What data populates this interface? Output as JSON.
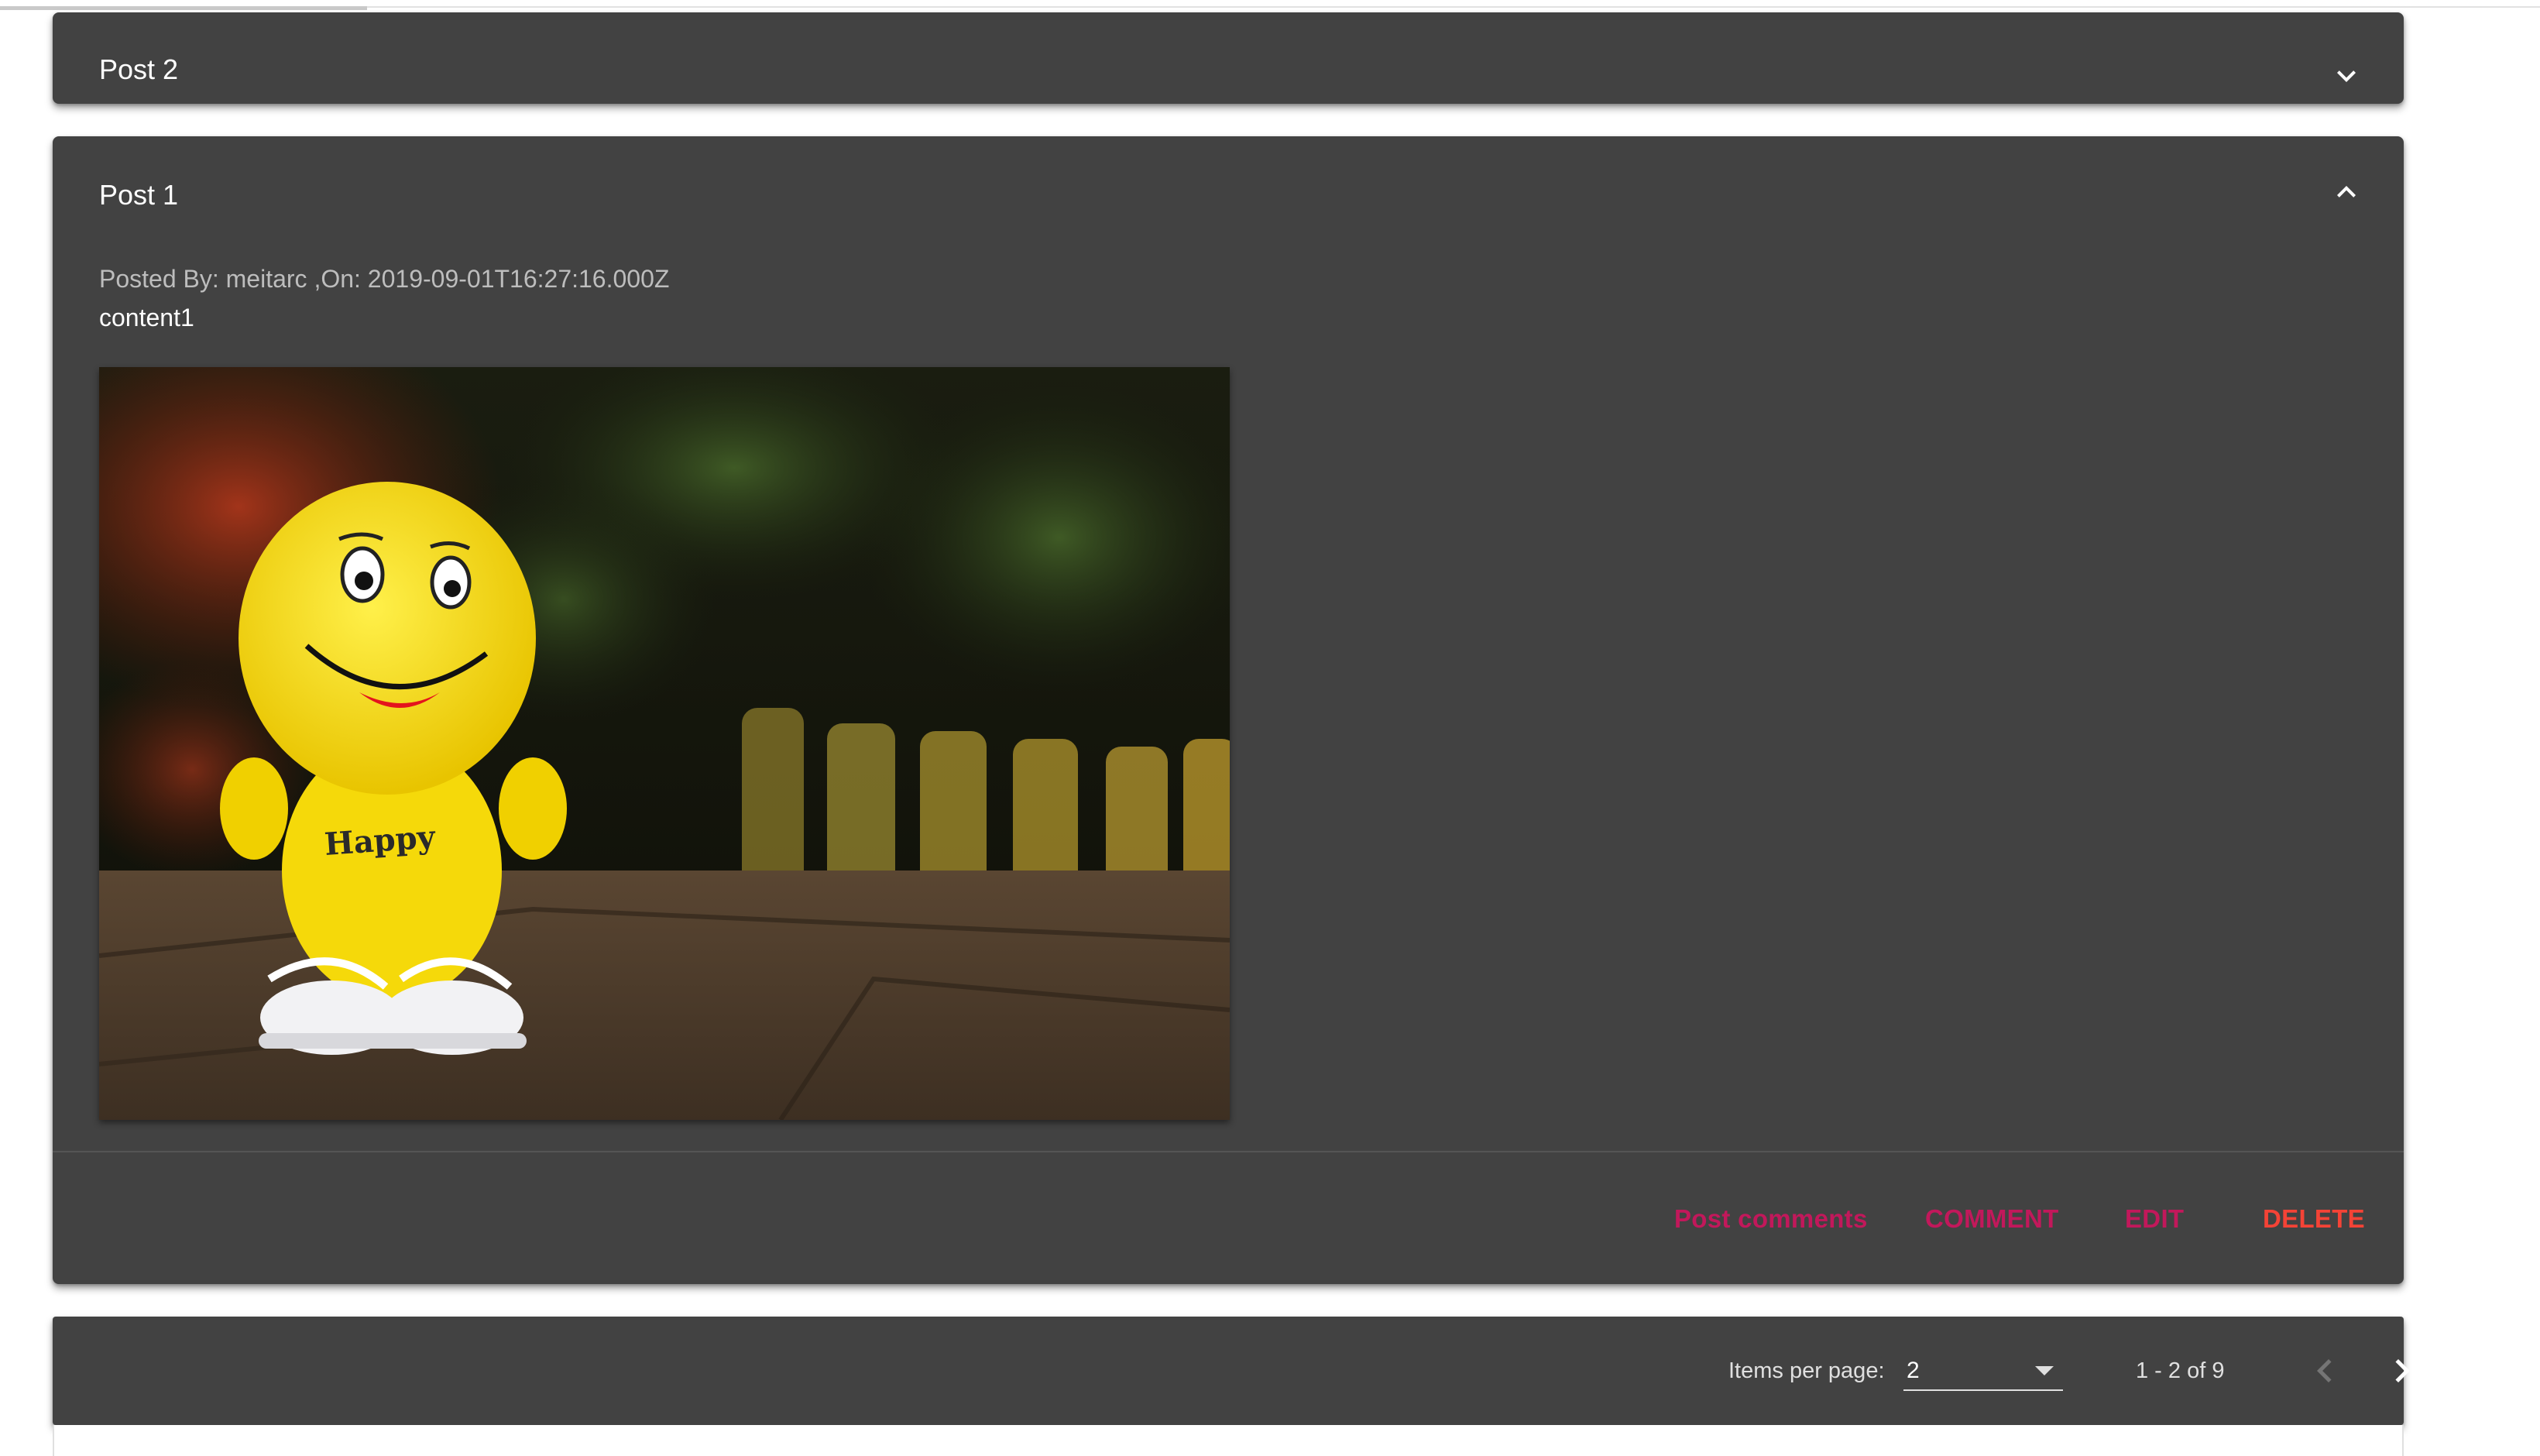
{
  "posts": [
    {
      "title": "Post 2",
      "expanded": false
    },
    {
      "title": "Post 1",
      "expanded": true,
      "meta": "Posted By: meitarc ,On: 2019-09-01T16:27:16.000Z",
      "content": "content1",
      "image_icon": "smiley-plush-toy-photo",
      "image_text": "Happy",
      "actions": {
        "post_comments": "Post comments",
        "comment": "COMMENT",
        "edit": "EDIT",
        "delete": "DELETE"
      }
    }
  ],
  "paginator": {
    "items_per_page_label": "Items per page:",
    "items_per_page_value": "2",
    "range_label": "1 - 2 of 9",
    "prev_icon": "chevron-left-icon",
    "next_icon": "chevron-right-icon"
  },
  "colors": {
    "panel": "#424242",
    "accent": "#c2185b",
    "warn": "#f44336"
  }
}
